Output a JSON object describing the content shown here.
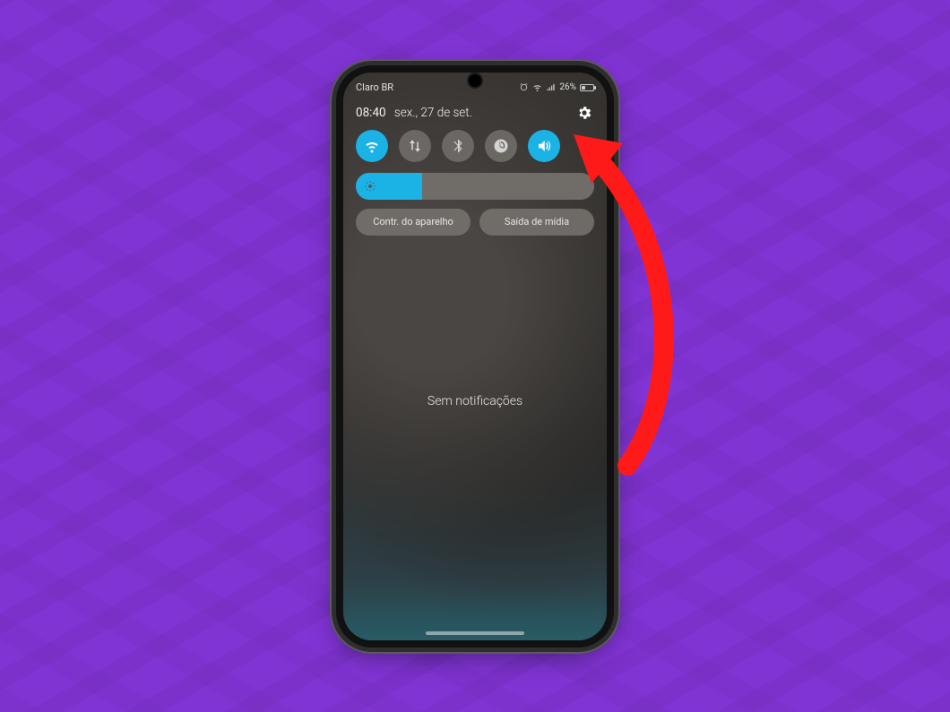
{
  "background": {
    "accent": "#8134d4"
  },
  "annotation": {
    "color": "#ff1a1a",
    "target": "settings-gear"
  },
  "status_bar": {
    "carrier": "Claro BR",
    "battery_text": "26%",
    "battery_level_pct": 26
  },
  "panel": {
    "time": "08:40",
    "date": "sex., 27 de set.",
    "settings_icon": "gear-icon"
  },
  "quick_toggles": [
    {
      "name": "wifi",
      "icon": "wifi-icon",
      "active": true
    },
    {
      "name": "data-sync",
      "icon": "arrows-vert-icon",
      "active": false
    },
    {
      "name": "bluetooth",
      "icon": "bluetooth-icon",
      "active": false
    },
    {
      "name": "power-mode",
      "icon": "power-icon",
      "active": false
    },
    {
      "name": "sound",
      "icon": "volume-icon",
      "active": true
    }
  ],
  "brightness": {
    "percent": 28
  },
  "pill_buttons": {
    "device_control": "Contr. do aparelho",
    "media_output": "Saída de mídia"
  },
  "notifications": {
    "empty_text": "Sem notificações"
  }
}
